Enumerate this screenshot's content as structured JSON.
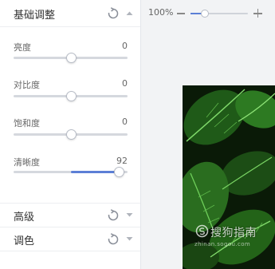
{
  "panel": {
    "basic": {
      "title": "基础调整",
      "reset_icon": "reset-icon",
      "caret_icon": "chevron-up-icon",
      "adjustments": [
        {
          "label": "亮度",
          "value": "0",
          "level": 0.5
        },
        {
          "label": "对比度",
          "value": "0",
          "level": 0.5
        },
        {
          "label": "饱和度",
          "value": "0",
          "level": 0.5
        },
        {
          "label": "清晰度",
          "value": "92",
          "level": 0.92
        }
      ]
    },
    "advanced": {
      "title": "高级",
      "reset_icon": "reset-icon",
      "caret_icon": "chevron-down-icon"
    },
    "color": {
      "title": "调色",
      "reset_icon": "reset-icon",
      "caret_icon": "chevron-down-icon"
    }
  },
  "zoom": {
    "percent_label": "100%",
    "level": 0.25,
    "minus_icon": "minus-icon",
    "plus_icon": "plus-icon"
  },
  "canvas": {
    "image_subject": "green leaves photo",
    "watermark": {
      "main": "搜狗指南",
      "sub": "zhinan.sogou.com"
    }
  },
  "colors": {
    "accent": "#5c7fd6",
    "panel_bg": "#ffffff",
    "canvas_bg": "#f2f3f5"
  }
}
